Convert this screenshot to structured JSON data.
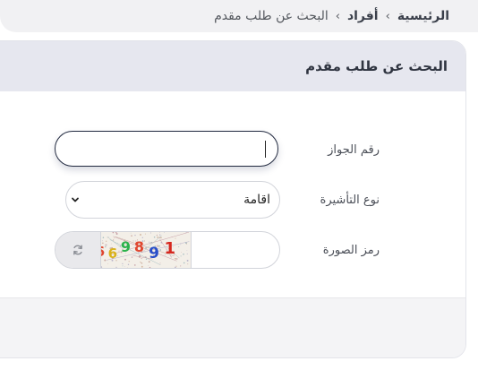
{
  "breadcrumb": {
    "items": [
      "الرئيسية",
      "أفراد",
      "البحث عن طلب مقدم"
    ]
  },
  "card": {
    "title": "البحث عن طلب مقدم"
  },
  "form": {
    "passport": {
      "label": "رقم الجواز",
      "value": ""
    },
    "visa_type": {
      "label": "نوع التأشيرة",
      "selected": "اقامة"
    },
    "captcha": {
      "label": "رمز الصورة",
      "value": "",
      "digits": [
        {
          "char": "6",
          "color": "#e0462f"
        },
        {
          "char": "6",
          "color": "#d9b21c"
        },
        {
          "char": "9",
          "color": "#2bb24c"
        },
        {
          "char": "8",
          "color": "#e0462f"
        },
        {
          "char": "9",
          "color": "#2a4fc9"
        },
        {
          "char": "1",
          "color": "#d6281f"
        }
      ]
    }
  },
  "icons": {
    "separator": "chevron-left-icon",
    "select": "chevron-down-icon",
    "refresh": "refresh-icon"
  }
}
